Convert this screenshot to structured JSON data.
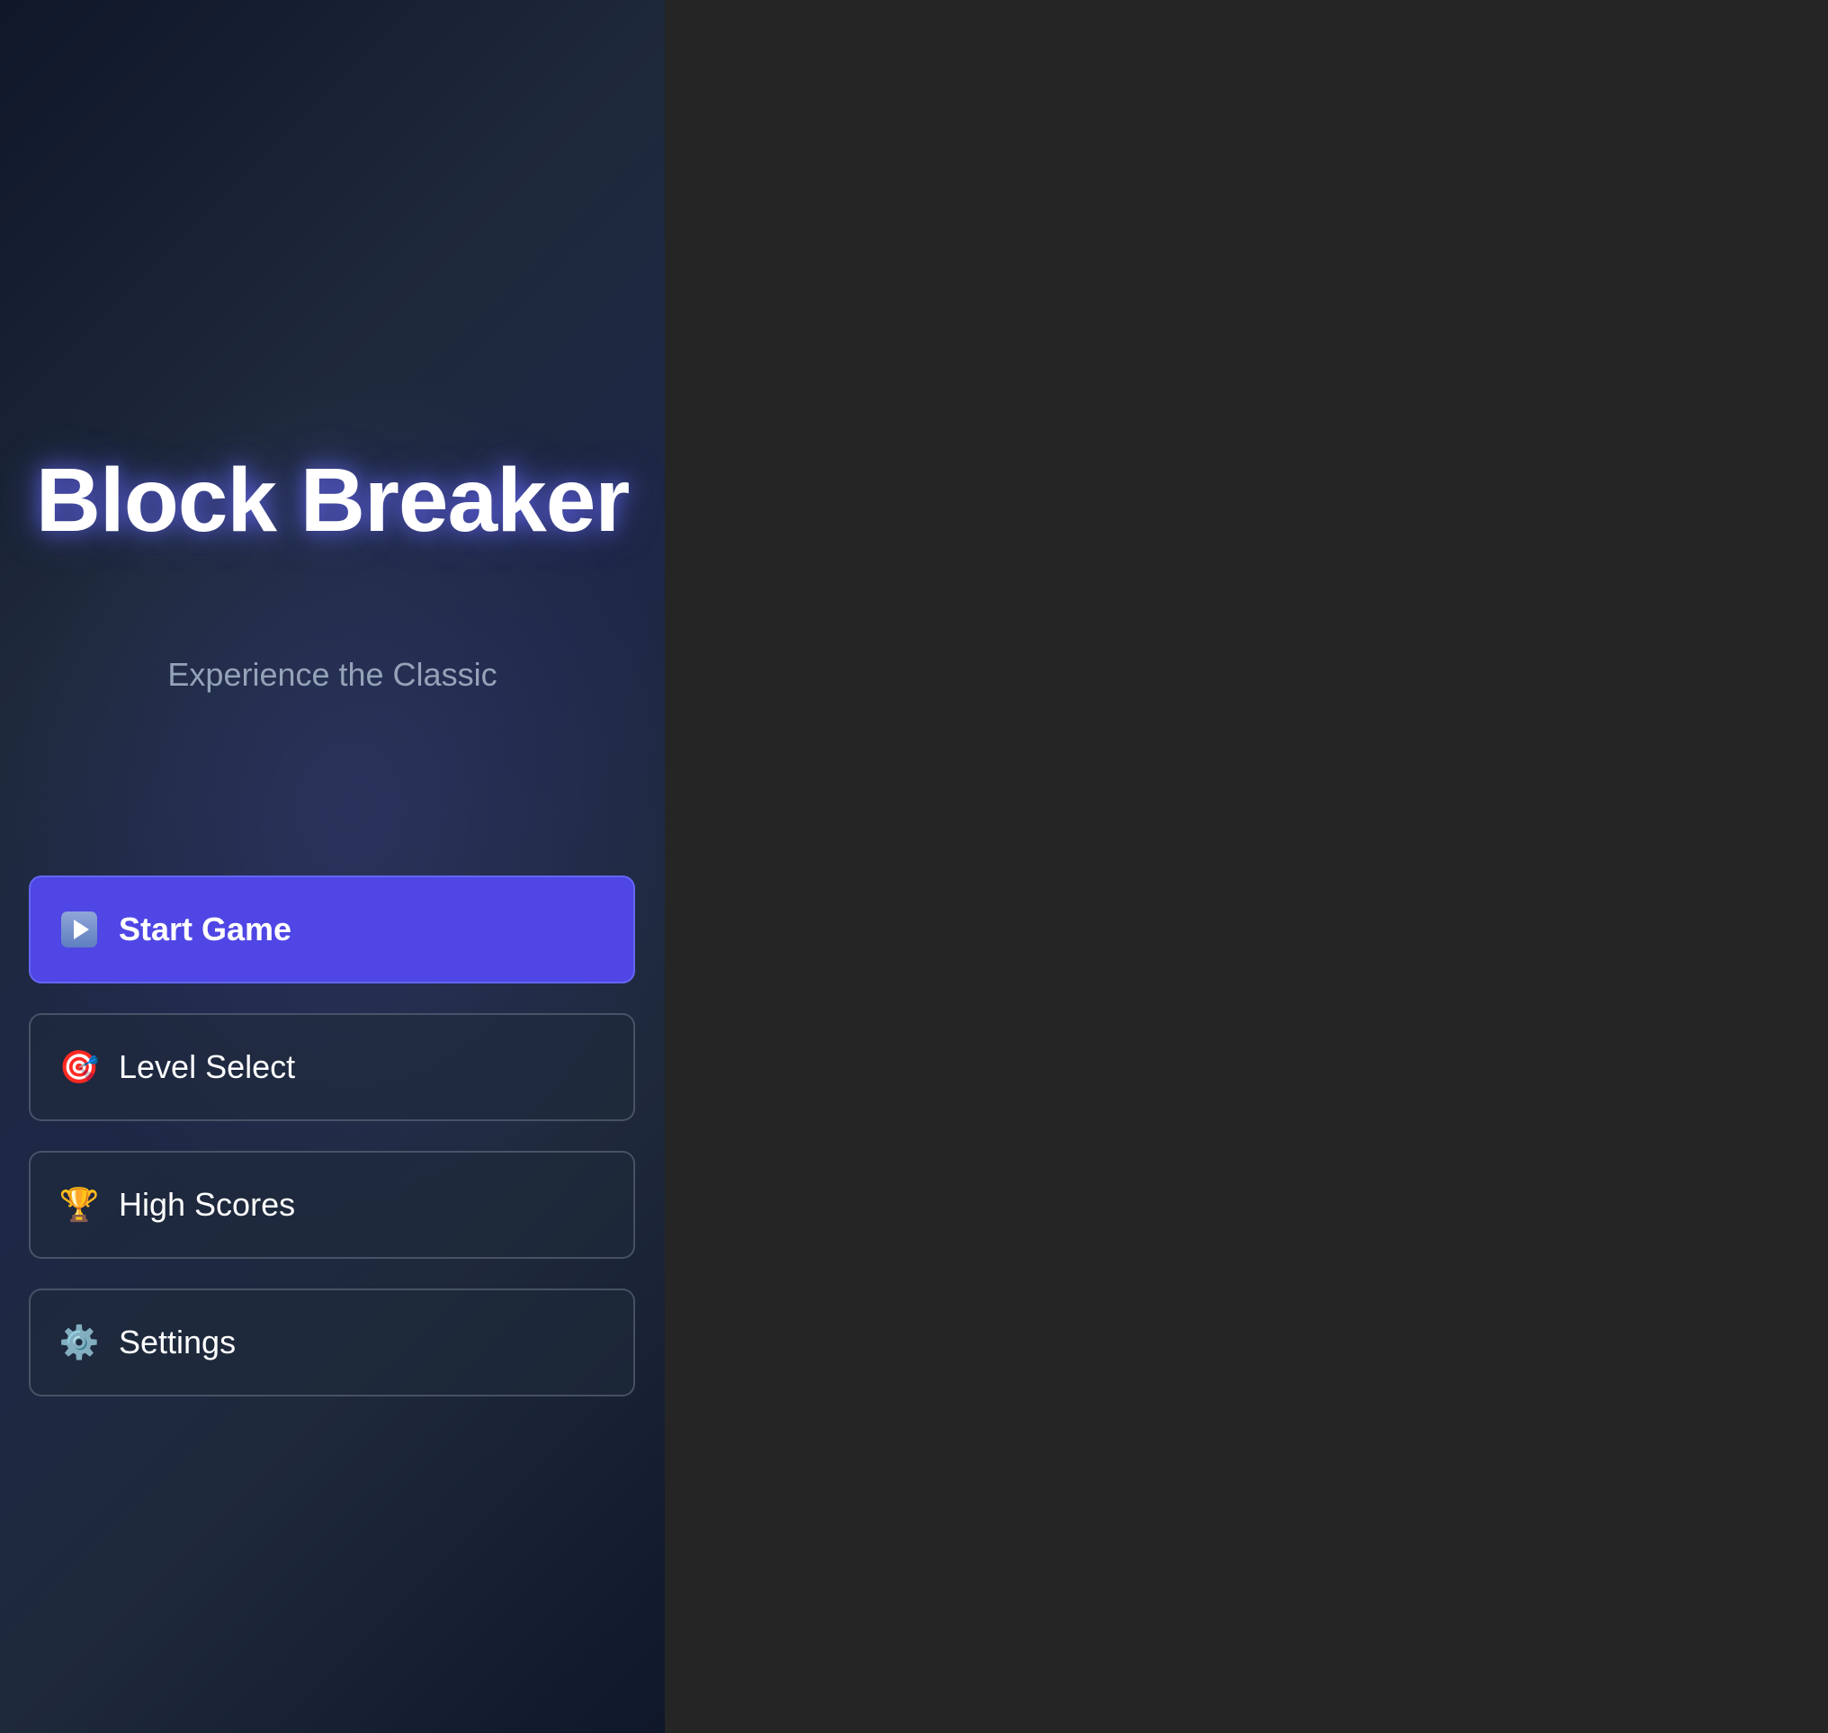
{
  "app": {
    "title": "Block Breaker",
    "subtitle": "Experience the Classic"
  },
  "menu": {
    "items": [
      {
        "label": "Start Game",
        "icon": "play-icon",
        "primary": true
      },
      {
        "label": "Level Select",
        "icon": "target-icon",
        "glyph": "🎯"
      },
      {
        "label": "High Scores",
        "icon": "trophy-icon",
        "glyph": "🏆"
      },
      {
        "label": "Settings",
        "icon": "gear-icon",
        "glyph": "⚙️"
      }
    ]
  },
  "colors": {
    "accent": "#4f46e5",
    "panel_dark": "#0f172a",
    "panel_mid": "#1e293b",
    "subtitle": "#94a3b8",
    "game_area": "#252525"
  }
}
